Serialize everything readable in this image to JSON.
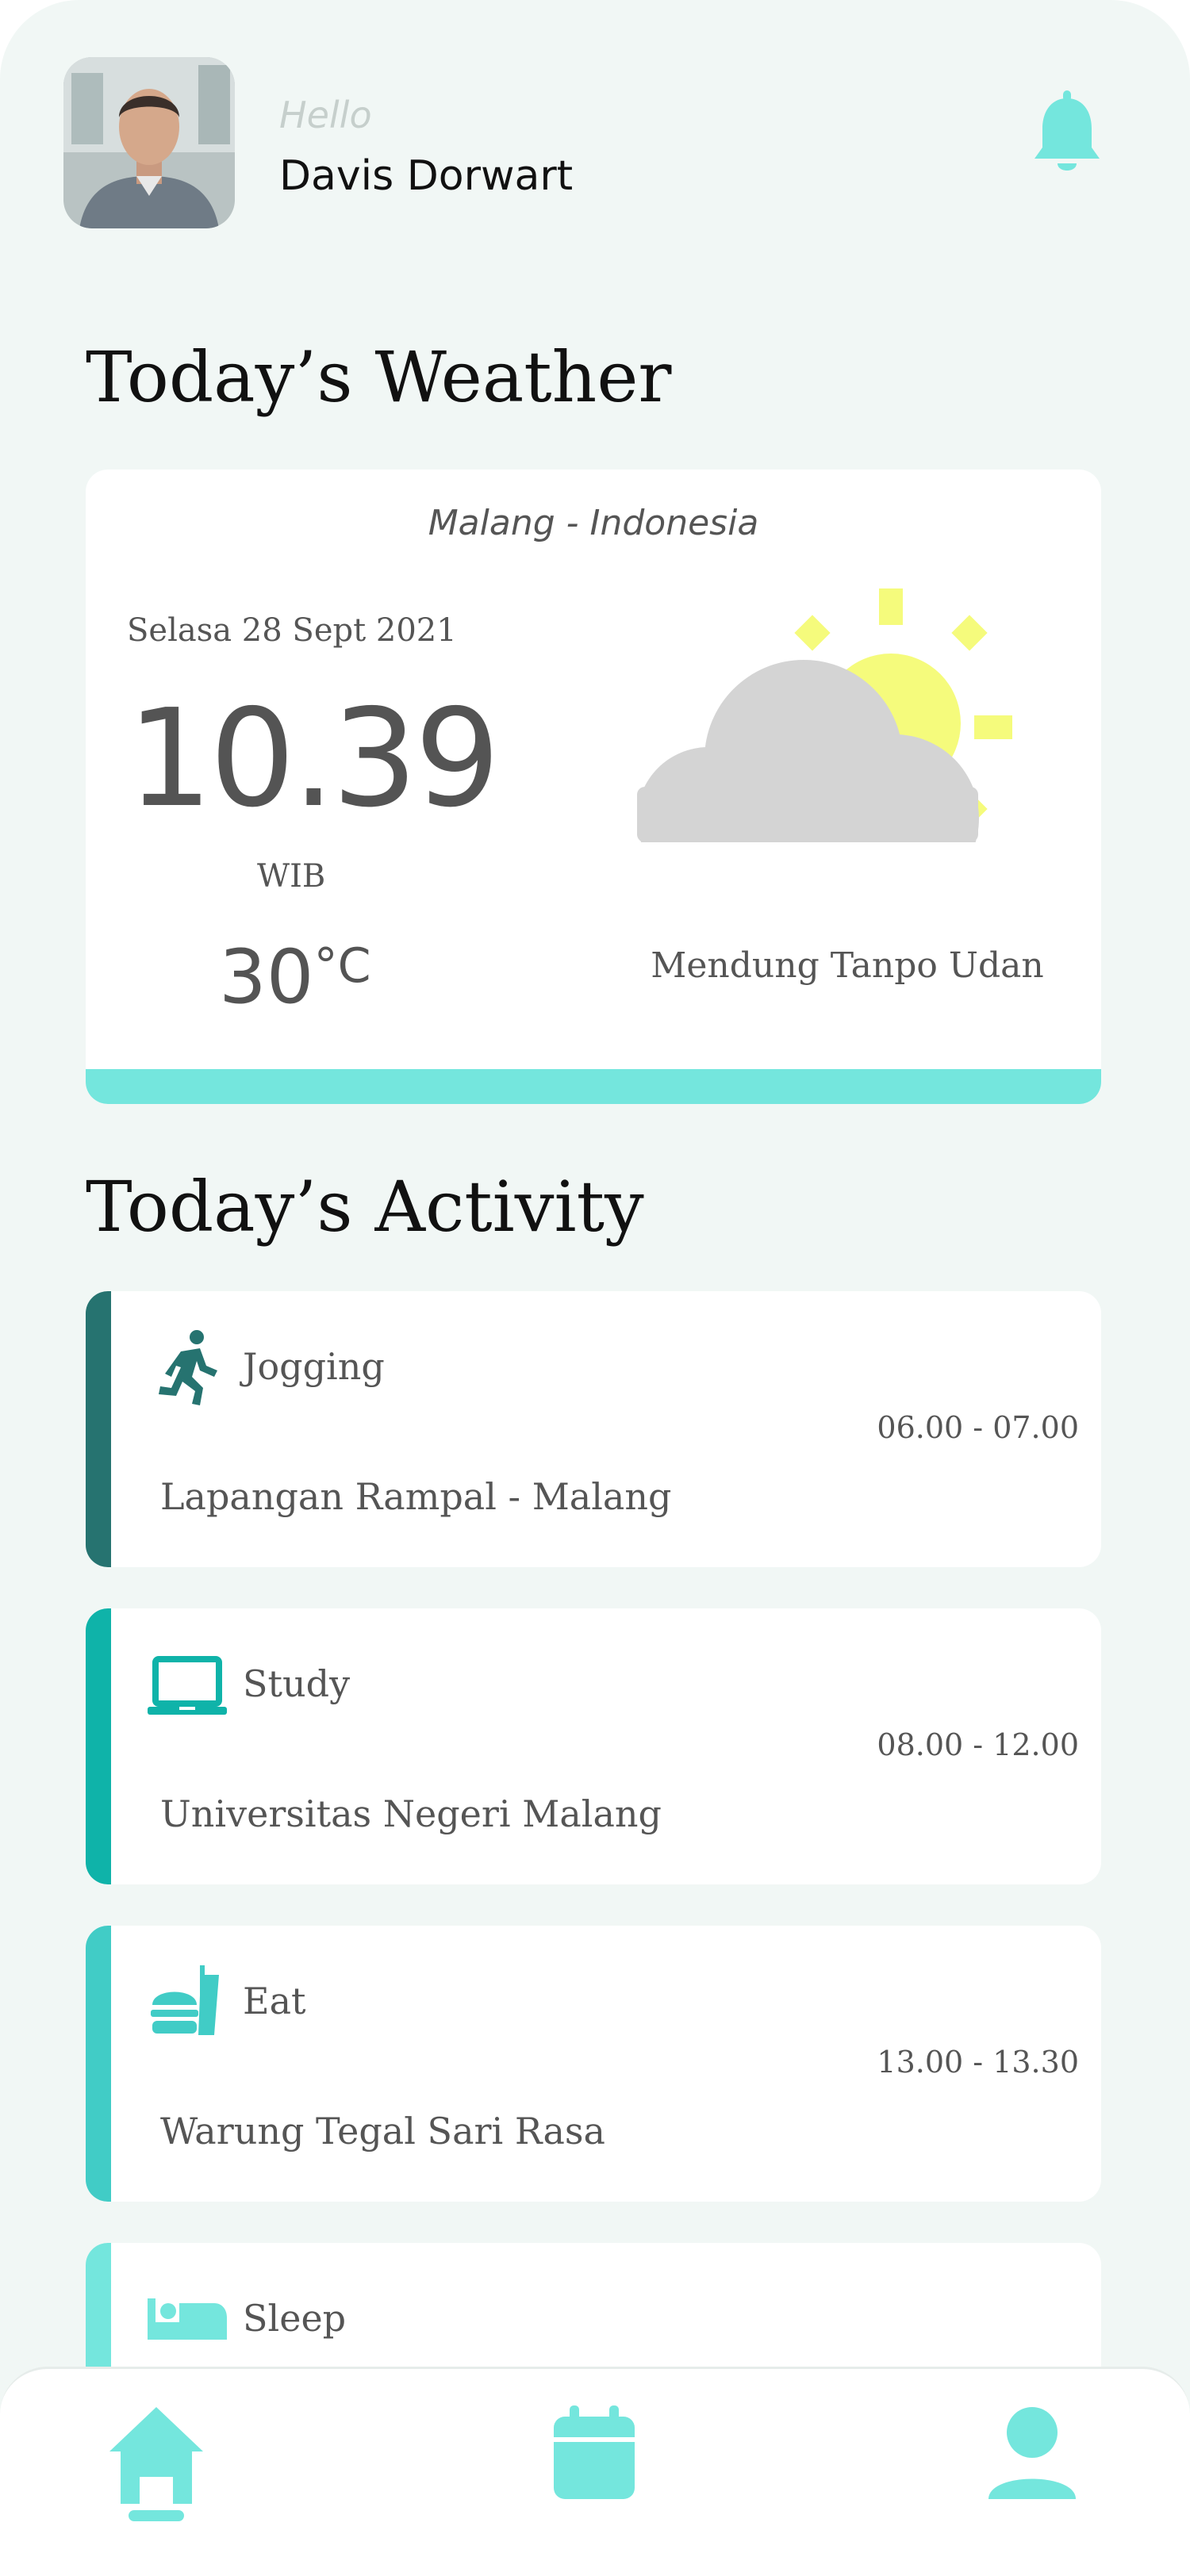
{
  "header": {
    "greeting": "Hello",
    "username": "Davis Dorwart"
  },
  "weather_section": {
    "title": "Today’s Weather",
    "location": "Malang - Indonesia",
    "date": "Selasa 28 Sept 2021",
    "time": "10.39",
    "timezone": "WIB",
    "temperature": "30",
    "temperature_unit": "°C",
    "condition": "Mendung Tanpo Udan",
    "icon": "partly-cloudy-icon"
  },
  "activity_section": {
    "title": "Today’s Activity",
    "items": [
      {
        "title": "Jogging",
        "time": "06.00 - 07.00",
        "place": "Lapangan Rampal - Malang",
        "icon": "running-icon",
        "color": "#267370"
      },
      {
        "title": "Study",
        "time": "08.00 - 12.00",
        "place": "Universitas Negeri Malang",
        "icon": "laptop-icon",
        "color": "#0fb3a9"
      },
      {
        "title": "Eat",
        "time": "13.00 - 13.30",
        "place": "Warung Tegal Sari Rasa",
        "icon": "fastfood-icon",
        "color": "#41ccc6"
      },
      {
        "title": "Sleep",
        "time": "",
        "place": "",
        "icon": "bed-icon",
        "color": "#74e6dd"
      }
    ]
  },
  "bottom_nav": {
    "items": [
      {
        "name": "home",
        "icon": "home-icon",
        "active": true
      },
      {
        "name": "calendar",
        "icon": "calendar-icon",
        "active": false
      },
      {
        "name": "profile",
        "icon": "person-icon",
        "active": false
      }
    ]
  },
  "colors": {
    "background": "#f1f7f5",
    "accent": "#74e6dd",
    "sun": "#f5fb7c",
    "cloud": "#d4d4d4",
    "text": "#555555"
  }
}
